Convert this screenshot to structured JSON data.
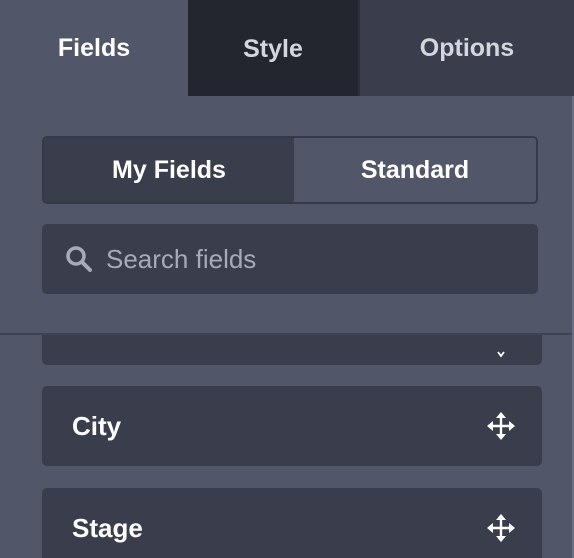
{
  "tabs": [
    {
      "label": "Fields",
      "active": true
    },
    {
      "label": "Style",
      "active": false
    },
    {
      "label": "Options",
      "active": false
    }
  ],
  "toggle": {
    "my_fields": "My Fields",
    "standard": "Standard",
    "selected": "Standard"
  },
  "search": {
    "placeholder": "Search fields",
    "value": ""
  },
  "fields": [
    {
      "label": ""
    },
    {
      "label": "City"
    },
    {
      "label": "Stage"
    }
  ],
  "icons": {
    "search": "search-icon",
    "move": "move-icon"
  },
  "colors": {
    "panel": "#525669",
    "dark_tab": "#24262f",
    "item_bg": "#3a3d4c"
  }
}
